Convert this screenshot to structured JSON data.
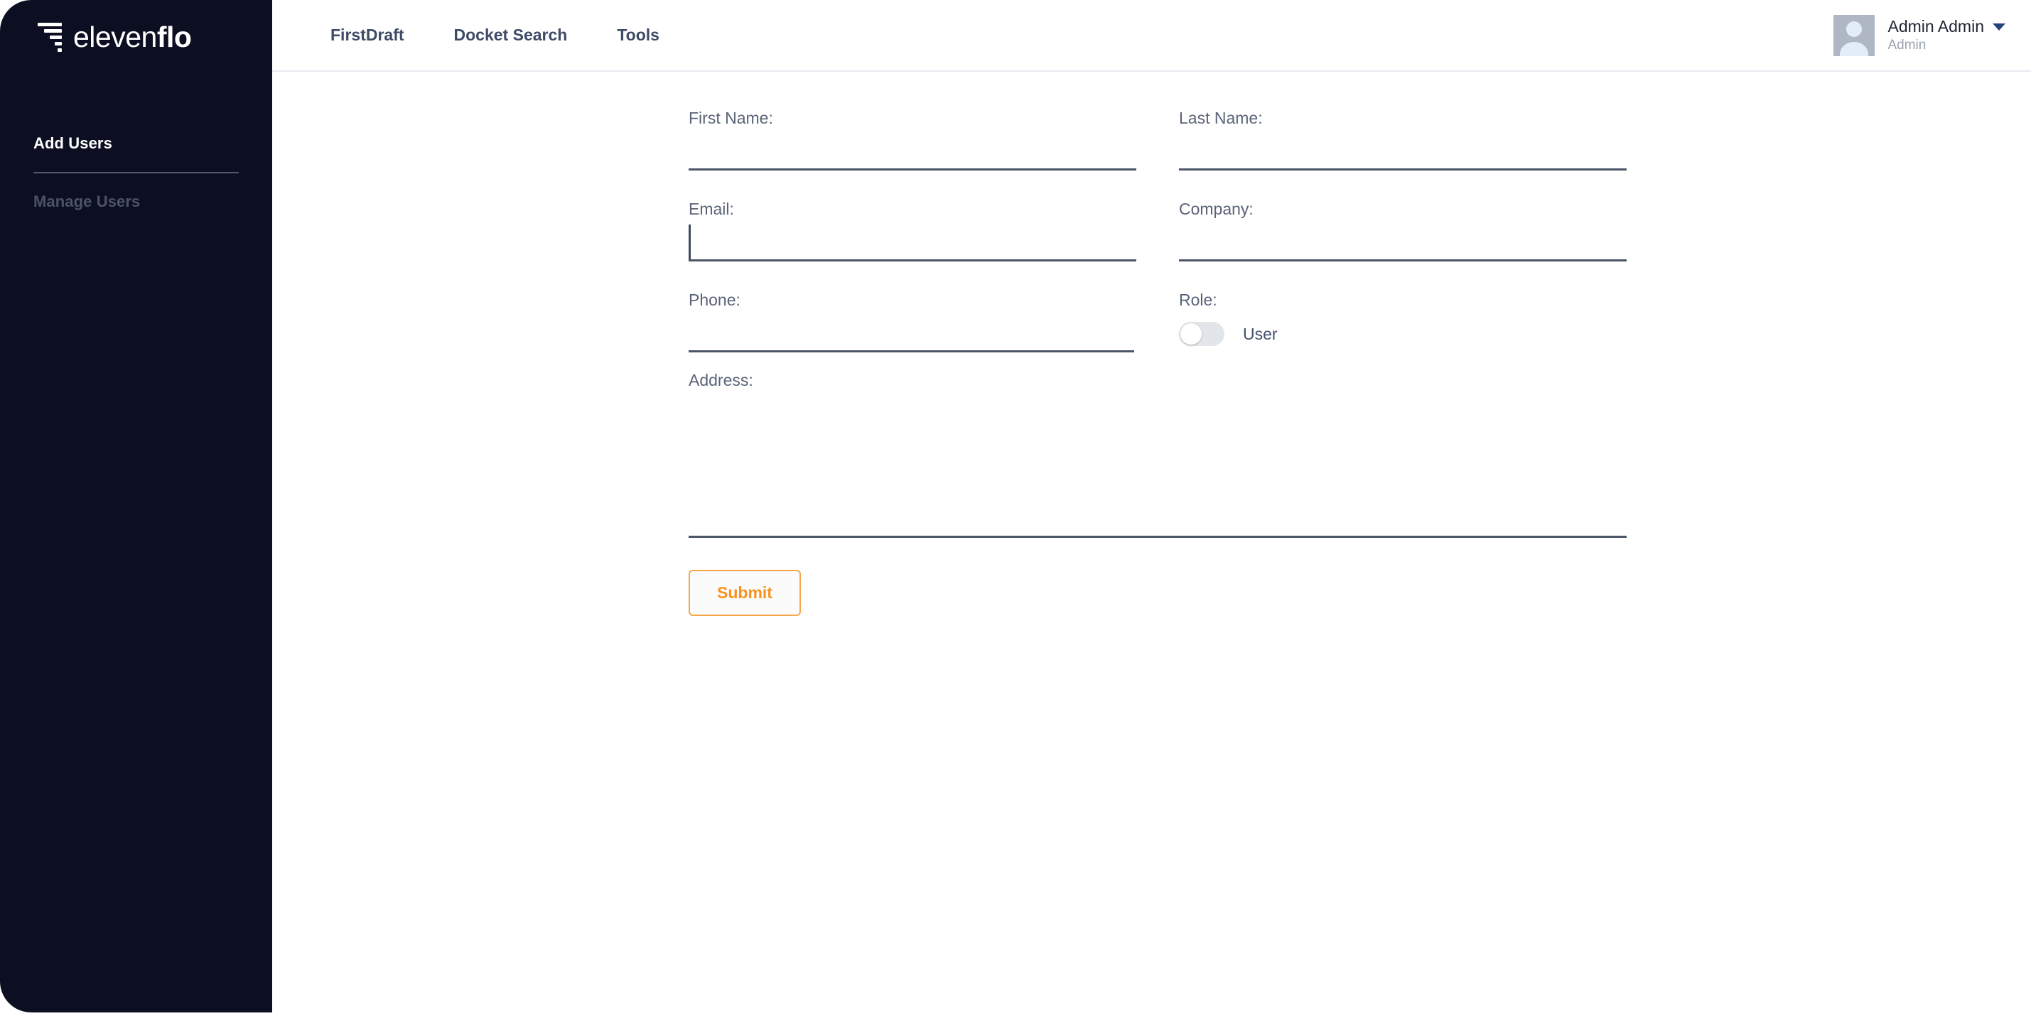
{
  "brand": {
    "name_light": "eleven",
    "name_bold": "flo",
    "logo_icon": "funnel-bars-icon"
  },
  "sidebar": {
    "items": [
      {
        "label": "Add Users",
        "active": true
      },
      {
        "label": "Manage Users",
        "active": false
      }
    ]
  },
  "header": {
    "nav": [
      {
        "label": "FirstDraft"
      },
      {
        "label": "Docket Search"
      },
      {
        "label": "Tools"
      }
    ],
    "profile": {
      "name": "Admin Admin",
      "role": "Admin",
      "avatar_icon": "user-avatar-icon",
      "caret_icon": "chevron-down-icon"
    }
  },
  "form": {
    "fields": {
      "first_name": {
        "label": "First Name:",
        "value": "",
        "placeholder": ""
      },
      "last_name": {
        "label": "Last Name:",
        "value": "",
        "placeholder": ""
      },
      "email": {
        "label": "Email:",
        "value": "",
        "placeholder": "",
        "focused": true
      },
      "company": {
        "label": "Company:",
        "value": "",
        "placeholder": ""
      },
      "phone": {
        "label": "Phone:",
        "value": "",
        "placeholder": ""
      },
      "role": {
        "label": "Role:",
        "toggle_label": "User",
        "toggle_on": false
      },
      "address": {
        "label": "Address:",
        "value": "",
        "placeholder": ""
      }
    },
    "submit_label": "Submit"
  },
  "colors": {
    "sidebar_bg": "#0C0F22",
    "accent_orange": "#F7931E",
    "label_gray": "#5A6478",
    "input_underline": "#4A5568",
    "nav_text": "#3E4A66",
    "muted_text": "#4D5367"
  }
}
